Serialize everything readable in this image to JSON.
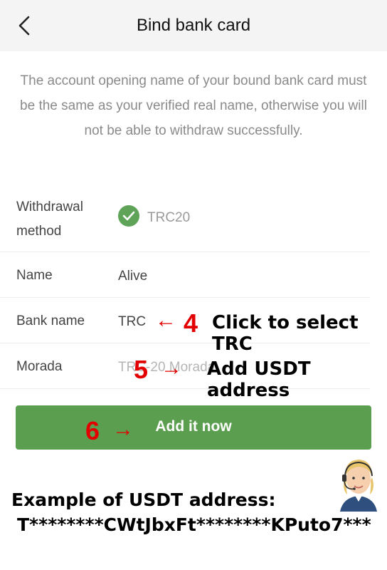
{
  "header": {
    "title": "Bind bank card",
    "back_icon": "chevron-left-icon"
  },
  "notice": "The account opening name of your bound bank card must be the same as your verified real name, otherwise you will not be able to withdraw successfully.",
  "form": {
    "withdrawal_method": {
      "label": "Withdrawal method",
      "value": "TRC20",
      "selected": true
    },
    "name": {
      "label": "Name",
      "value": "Alive"
    },
    "bank_name": {
      "label": "Bank name",
      "value": "TRC"
    },
    "morada": {
      "label": "Morada",
      "placeholder": "TRC-20 Morada"
    }
  },
  "annotations": {
    "step4": {
      "number": "4",
      "arrow": "←",
      "text": "Click to select TRC"
    },
    "step5": {
      "number": "5",
      "arrow": "→",
      "text": "Add USDT address"
    },
    "step6": {
      "number": "6",
      "arrow": "→"
    }
  },
  "add_button": {
    "label": "Add it now"
  },
  "example": {
    "title": "Example of USDT address:",
    "value": "T********CWtJbxFt********KPuto7***"
  },
  "colors": {
    "accent": "#5c9e4f",
    "check": "#5ea358",
    "annotation": "#e30000"
  }
}
